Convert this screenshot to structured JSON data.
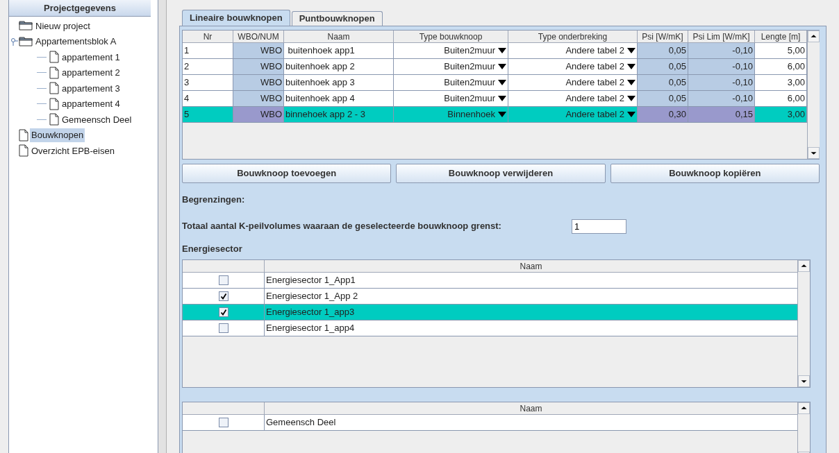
{
  "sidebar": {
    "title": "Projectgegevens",
    "tree": [
      {
        "label": "Nieuw project",
        "kind": "folder",
        "selected": false
      },
      {
        "label": "Appartementsblok A",
        "kind": "folder",
        "selected": false,
        "expanded": true,
        "children": [
          {
            "label": "appartement 1",
            "kind": "file",
            "selected": false
          },
          {
            "label": "appartement 2",
            "kind": "file",
            "selected": false
          },
          {
            "label": "appartement 3",
            "kind": "file",
            "selected": false
          },
          {
            "label": "appartement 4",
            "kind": "file",
            "selected": false
          },
          {
            "label": "Gemeensch Deel",
            "kind": "file",
            "selected": false
          }
        ]
      },
      {
        "label": "Bouwknopen",
        "kind": "file",
        "selected": true
      },
      {
        "label": "Overzicht EPB-eisen",
        "kind": "file",
        "selected": false
      }
    ]
  },
  "tabs": [
    {
      "label": "Lineaire bouwknopen",
      "selected": true
    },
    {
      "label": "Puntbouwknopen",
      "selected": false
    }
  ],
  "table": {
    "columns": [
      {
        "label": "Nr",
        "kind": "text"
      },
      {
        "label": "WBO/NUM",
        "kind": "readonly"
      },
      {
        "label": "Naam",
        "kind": "text"
      },
      {
        "label": "Type bouwknoop",
        "kind": "dropdown"
      },
      {
        "label": "Type onderbreking",
        "kind": "dropdown"
      },
      {
        "label": "Psi [W/mK]",
        "kind": "readonly"
      },
      {
        "label": "Psi Lim [W/mK]",
        "kind": "readonly"
      },
      {
        "label": "Lengte [m]",
        "kind": "number"
      }
    ],
    "rows": [
      {
        "selected": false,
        "cells": [
          "1",
          "WBO",
          " buitenhoek app1",
          "Buiten2muur",
          "Andere tabel 2",
          "0,05",
          "-0,10",
          "5,00"
        ]
      },
      {
        "selected": false,
        "cells": [
          "2",
          "WBO",
          "buitenhoek app 2",
          "Buiten2muur",
          "Andere tabel 2",
          "0,05",
          "-0,10",
          "6,00"
        ]
      },
      {
        "selected": false,
        "cells": [
          "3",
          "WBO",
          "buitenhoek app 3",
          "Buiten2muur",
          "Andere tabel 2",
          "0,05",
          "-0,10",
          "3,00"
        ]
      },
      {
        "selected": false,
        "cells": [
          "4",
          "WBO",
          "buitenhoek app 4",
          "Buiten2muur",
          "Andere tabel 2",
          "0,05",
          "-0,10",
          "6,00"
        ]
      },
      {
        "selected": true,
        "cells": [
          "5",
          "WBO",
          "binnehoek app 2 - 3",
          "Binnenhoek",
          "Andere tabel 2",
          "0,30",
          "0,15",
          "3,00"
        ]
      }
    ]
  },
  "buttons": [
    "Bouwknoop toevoegen",
    "Bouwknoop verwijderen",
    "Bouwknoop kopiëren"
  ],
  "begrenzingen_label": "Begrenzingen:",
  "k_volumes": {
    "label": "Totaal aantal K-peilvolumes waaraan de geselecteerde bouwknoop grenst:",
    "value": "1"
  },
  "energiesector": {
    "title": "Energiesector",
    "column": "Naam",
    "rows": [
      {
        "label": "Energiesector 1_App1",
        "checked": false,
        "selected": false
      },
      {
        "label": "Energiesector 1_App 2",
        "checked": true,
        "selected": false
      },
      {
        "label": "Energiesector 1_app3",
        "checked": true,
        "selected": true
      },
      {
        "label": "Energiesector 1_app4",
        "checked": false,
        "selected": false
      }
    ]
  },
  "shared_table": {
    "column": "Naam",
    "rows": [
      {
        "label": "Gemeensch Deel",
        "checked": false,
        "selected": false
      }
    ]
  }
}
